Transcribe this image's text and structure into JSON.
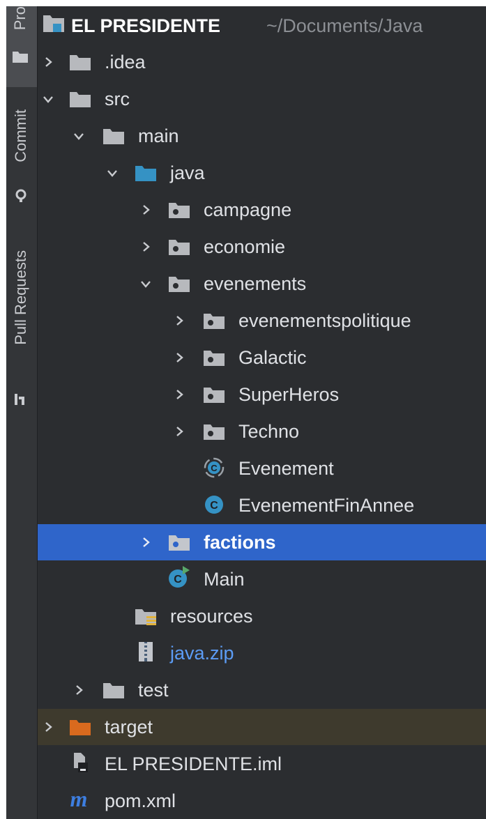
{
  "stripe": {
    "project_tab": "Pro",
    "commit_tab": "Commit",
    "pull_requests_tab": "Pull Requests"
  },
  "tree": {
    "root_name": "EL PRESIDENTE",
    "root_path": "~/Documents/Java",
    "items": [
      {
        "label": ".idea"
      },
      {
        "label": "src"
      },
      {
        "label": "main"
      },
      {
        "label": "java"
      },
      {
        "label": "campagne"
      },
      {
        "label": "economie"
      },
      {
        "label": "evenements"
      },
      {
        "label": "evenementspolitique"
      },
      {
        "label": "Galactic"
      },
      {
        "label": "SuperHeros"
      },
      {
        "label": "Techno"
      },
      {
        "label": "Evenement"
      },
      {
        "label": "EvenementFinAnnee"
      },
      {
        "label": "factions"
      },
      {
        "label": "Main"
      },
      {
        "label": "resources"
      },
      {
        "label": "java.zip"
      },
      {
        "label": "test"
      },
      {
        "label": "target"
      },
      {
        "label": "EL PRESIDENTE.iml"
      },
      {
        "label": "pom.xml"
      }
    ]
  },
  "colors": {
    "background": "#2b2d30",
    "selection": "#2f65ca",
    "folder": "#b7b9bd",
    "source_folder": "#3592c4",
    "excluded_folder": "#d96a1e",
    "class_icon": "#3592c4",
    "link_text": "#5c9cf5"
  }
}
